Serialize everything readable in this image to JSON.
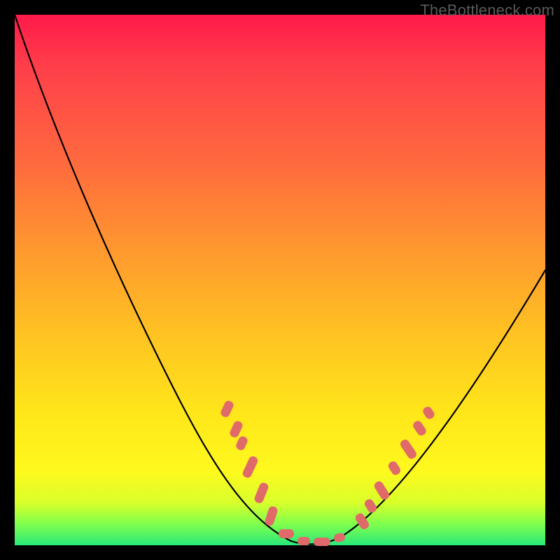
{
  "watermark": "TheBottleneck.com",
  "colors": {
    "frame": "#000000",
    "curve": "#000000",
    "marker": "#e06a6a",
    "gradient_top": "#ff1a4a",
    "gradient_bottom": "#28e87a"
  },
  "chart_data": {
    "type": "line",
    "title": "",
    "xlabel": "",
    "ylabel": "",
    "xlim": [
      0,
      100
    ],
    "ylim": [
      0,
      100
    ],
    "x": [
      0,
      3,
      8,
      14,
      20,
      26,
      32,
      38,
      42,
      46,
      50,
      54,
      58,
      62,
      66,
      72,
      80,
      88,
      96,
      100
    ],
    "y": [
      100,
      92,
      82,
      70,
      58,
      47,
      36,
      26,
      17,
      10,
      4,
      1,
      0,
      1,
      5,
      13,
      25,
      38,
      50,
      56
    ],
    "markers": {
      "note": "highlighted data points along the lower portion of the curve",
      "x": [
        40,
        42,
        44,
        46,
        48,
        50,
        54,
        56,
        58,
        60,
        64,
        66,
        68,
        70
      ],
      "y": [
        22,
        18,
        15,
        11,
        7,
        4,
        1,
        0,
        0,
        1,
        5,
        8,
        12,
        17
      ]
    }
  }
}
